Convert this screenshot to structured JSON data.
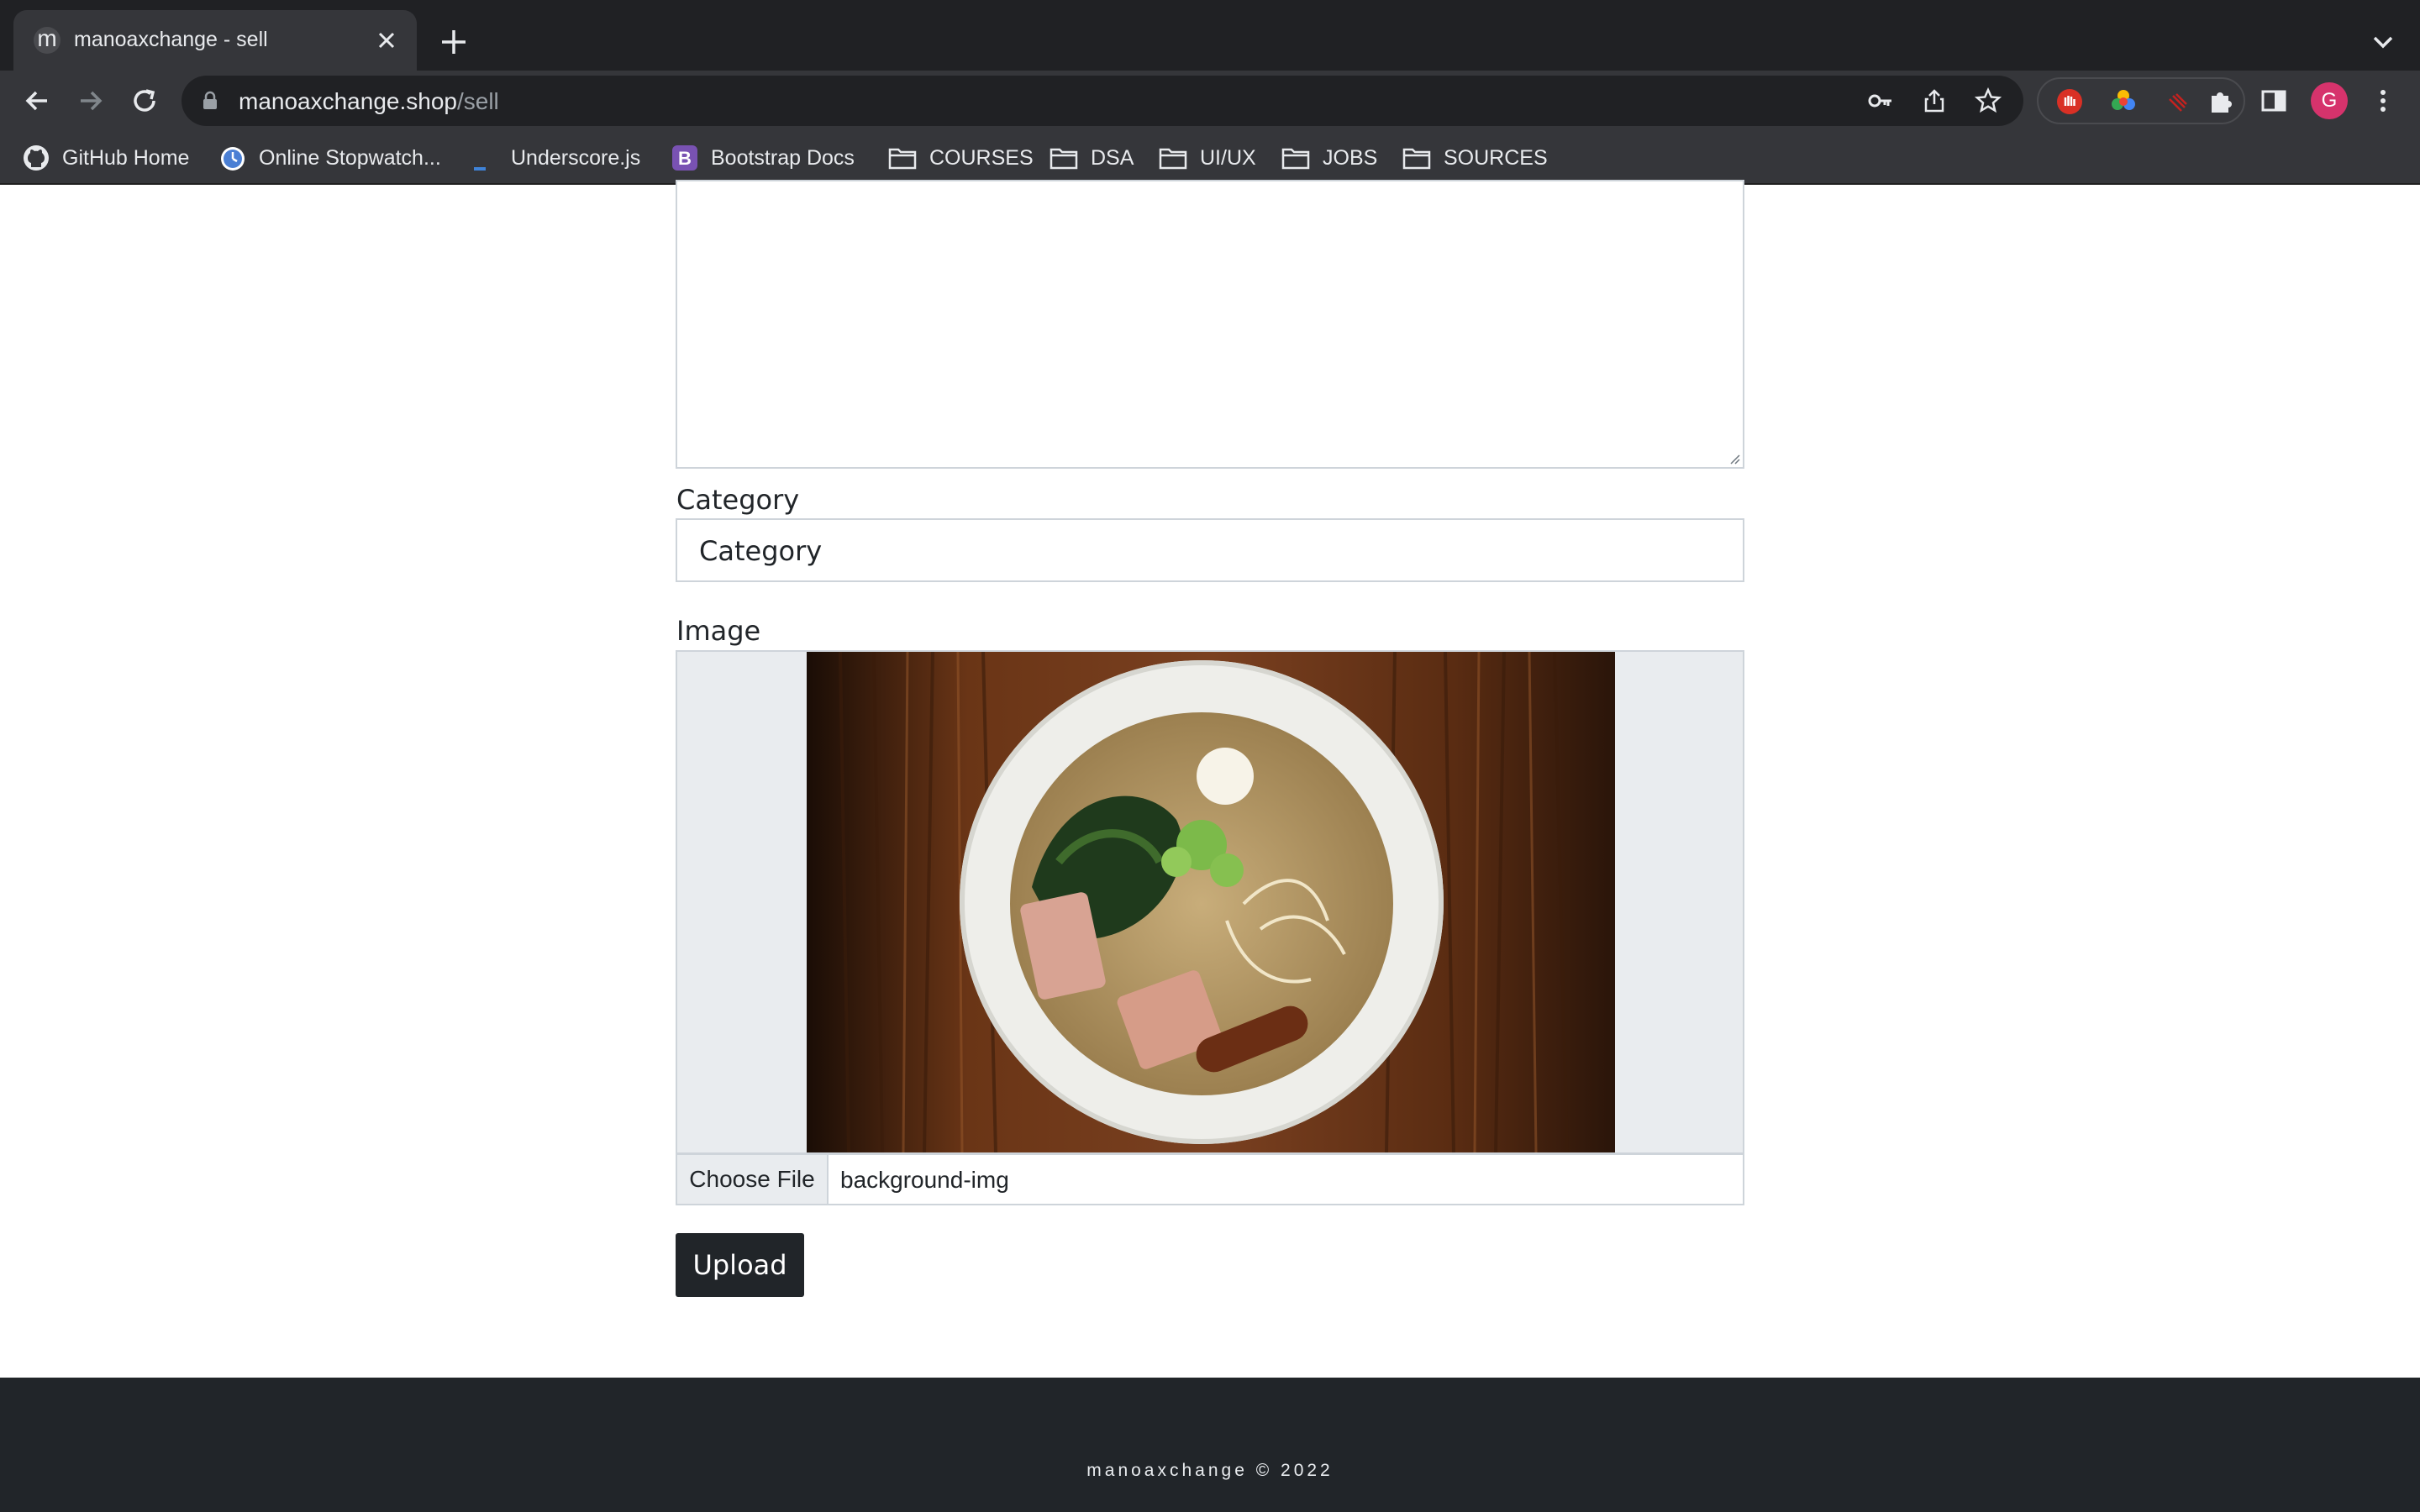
{
  "browser": {
    "tab_title": "manoaxchange - sell",
    "tab_favicon": "m",
    "url_host": "manoaxchange.shop",
    "url_path": "/sell",
    "avatar_initial": "G",
    "bookmarks": [
      {
        "label": "GitHub Home",
        "icon": "github-icon"
      },
      {
        "label": "Online Stopwatch...",
        "icon": "stopwatch-icon"
      },
      {
        "label": "Underscore.js",
        "icon": "underscore-icon"
      },
      {
        "label": "Bootstrap Docs",
        "icon": "bootstrap-icon"
      },
      {
        "label": "COURSES",
        "icon": "folder-icon"
      },
      {
        "label": "DSA",
        "icon": "folder-icon"
      },
      {
        "label": "UI/UX",
        "icon": "folder-icon"
      },
      {
        "label": "JOBS",
        "icon": "folder-icon"
      },
      {
        "label": "SOURCES",
        "icon": "folder-icon"
      }
    ]
  },
  "form": {
    "category_label": "Category",
    "category_value": "Category",
    "image_label": "Image",
    "choose_file_label": "Choose File",
    "file_name": "background-img",
    "upload_label": "Upload"
  },
  "footer": {
    "text": "manoaxchange © 2022"
  },
  "colors": {
    "chrome_dark": "#202124",
    "chrome_toolbar": "#35363a",
    "footer_bg": "#212529",
    "button_bg": "#212529",
    "input_border": "#ced4da"
  }
}
